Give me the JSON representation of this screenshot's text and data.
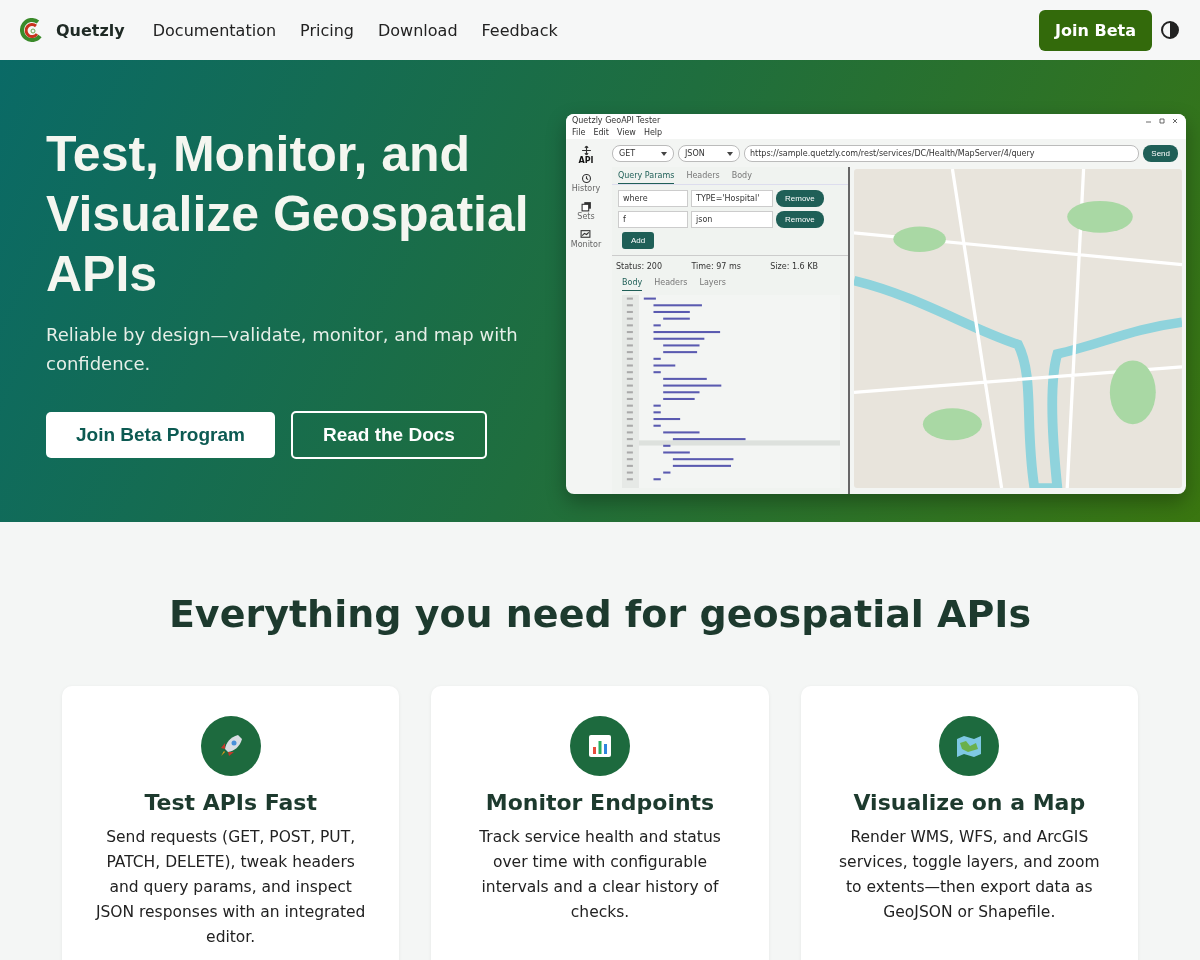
{
  "nav": {
    "brand": "Quetzly",
    "links": [
      "Documentation",
      "Pricing",
      "Download",
      "Feedback"
    ],
    "cta": "Join Beta"
  },
  "hero": {
    "title": "Test, Monitor, and Visualize Geospatial APIs",
    "subtitle": "Reliable by design—validate, monitor, and map with confidence.",
    "buttons": [
      {
        "label": "Join Beta Program",
        "kind": "primary"
      },
      {
        "label": "Read the Docs",
        "kind": "outline"
      }
    ]
  },
  "app_window": {
    "title": "Quetzly GeoAPI Tester",
    "menu": [
      "File",
      "Edit",
      "View",
      "Help"
    ],
    "sidebar": [
      {
        "label": "API",
        "selected": true
      },
      {
        "label": "History",
        "selected": false
      },
      {
        "label": "Sets",
        "selected": false
      },
      {
        "label": "Monitor",
        "selected": false
      }
    ],
    "method": "GET",
    "format": "JSON",
    "url": "https://sample.quetzly.com/rest/services/DC/Health/MapServer/4/query",
    "send": "Send",
    "request_tabs": [
      {
        "label": "Query Params",
        "selected": true
      },
      {
        "label": "Headers",
        "selected": false
      },
      {
        "label": "Body",
        "selected": false
      }
    ],
    "params": [
      {
        "key": "where",
        "value": "TYPE='Hospital'",
        "action": "Remove"
      },
      {
        "key": "f",
        "value": "json",
        "action": "Remove"
      }
    ],
    "add": "Add",
    "status": "Status: 200",
    "time": "Time: 97 ms",
    "size": "Size: 1.6 KB",
    "response_tabs": [
      {
        "label": "Body",
        "selected": true
      },
      {
        "label": "Headers",
        "selected": false
      },
      {
        "label": "Layers",
        "selected": false
      }
    ]
  },
  "features": {
    "heading": "Everything you need for geospatial APIs",
    "cards": [
      {
        "title": "Test APIs Fast",
        "text": "Send requests (GET, POST, PUT, PATCH, DELETE), tweak headers and query params, and inspect JSON responses with an integrated editor."
      },
      {
        "title": "Monitor Endpoints",
        "text": "Track service health and status over time with configurable intervals and a clear history of checks."
      },
      {
        "title": "Visualize on a Map",
        "text": "Render WMS, WFS, and ArcGIS services, toggle layers, and zoom to extents—then export data as GeoJSON or Shapefile."
      }
    ]
  }
}
